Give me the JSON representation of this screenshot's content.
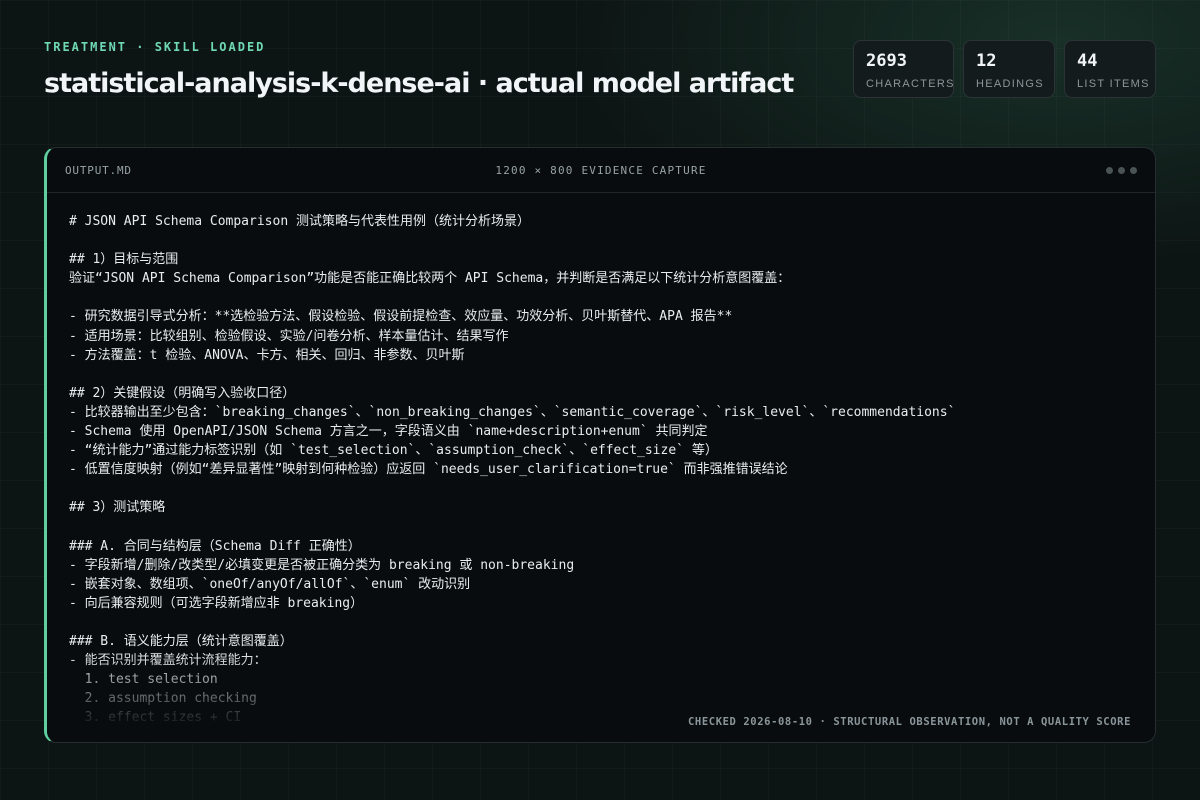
{
  "header": {
    "eyebrow": "TREATMENT · SKILL LOADED",
    "title": "statistical-analysis-k-dense-ai · actual model artifact"
  },
  "stats": [
    {
      "value": "2693",
      "label": "CHARACTERS"
    },
    {
      "value": "12",
      "label": "HEADINGS"
    },
    {
      "value": "44",
      "label": "LIST ITEMS"
    }
  ],
  "panel": {
    "filename": "OUTPUT.MD",
    "caption": "1200 × 800 EVIDENCE CAPTURE",
    "footnote": "CHECKED 2026-08-10 · STRUCTURAL OBSERVATION, NOT A QUALITY SCORE",
    "lines": [
      "# JSON API Schema Comparison 测试策略与代表性用例（统计分析场景）",
      "",
      "## 1）目标与范围",
      "验证“JSON API Schema Comparison”功能是否能正确比较两个 API Schema，并判断是否满足以下统计分析意图覆盖：",
      "",
      "- 研究数据引导式分析：**选检验方法、假设检验、假设前提检查、效应量、功效分析、贝叶斯替代、APA 报告**",
      "- 适用场景：比较组别、检验假设、实验/问卷分析、样本量估计、结果写作",
      "- 方法覆盖：t 检验、ANOVA、卡方、相关、回归、非参数、贝叶斯",
      "",
      "## 2）关键假设（明确写入验收口径）",
      "- 比较器输出至少包含：`breaking_changes`、`non_breaking_changes`、`semantic_coverage`、`risk_level`、`recommendations`",
      "- Schema 使用 OpenAPI/JSON Schema 方言之一，字段语义由 `name+description+enum` 共同判定",
      "- “统计能力”通过能力标签识别（如 `test_selection`、`assumption_check`、`effect_size` 等）",
      "- 低置信度映射（例如“差异显著性”映射到何种检验）应返回 `needs_user_clarification=true` 而非强推错误结论",
      "",
      "## 3）测试策略",
      "",
      "### A. 合同与结构层（Schema Diff 正确性）",
      "- 字段新增/删除/改类型/必填变更是否被正确分类为 breaking 或 non-breaking",
      "- 嵌套对象、数组项、`oneOf/anyOf/allOf`、`enum` 改动识别",
      "- 向后兼容规则（可选字段新增应非 breaking）",
      "",
      "### B. 语义能力层（统计意图覆盖）",
      "- 能否识别并覆盖统计流程能力：",
      "  1. test selection",
      "  2. assumption checking",
      "  3. effect sizes + CI"
    ]
  }
}
